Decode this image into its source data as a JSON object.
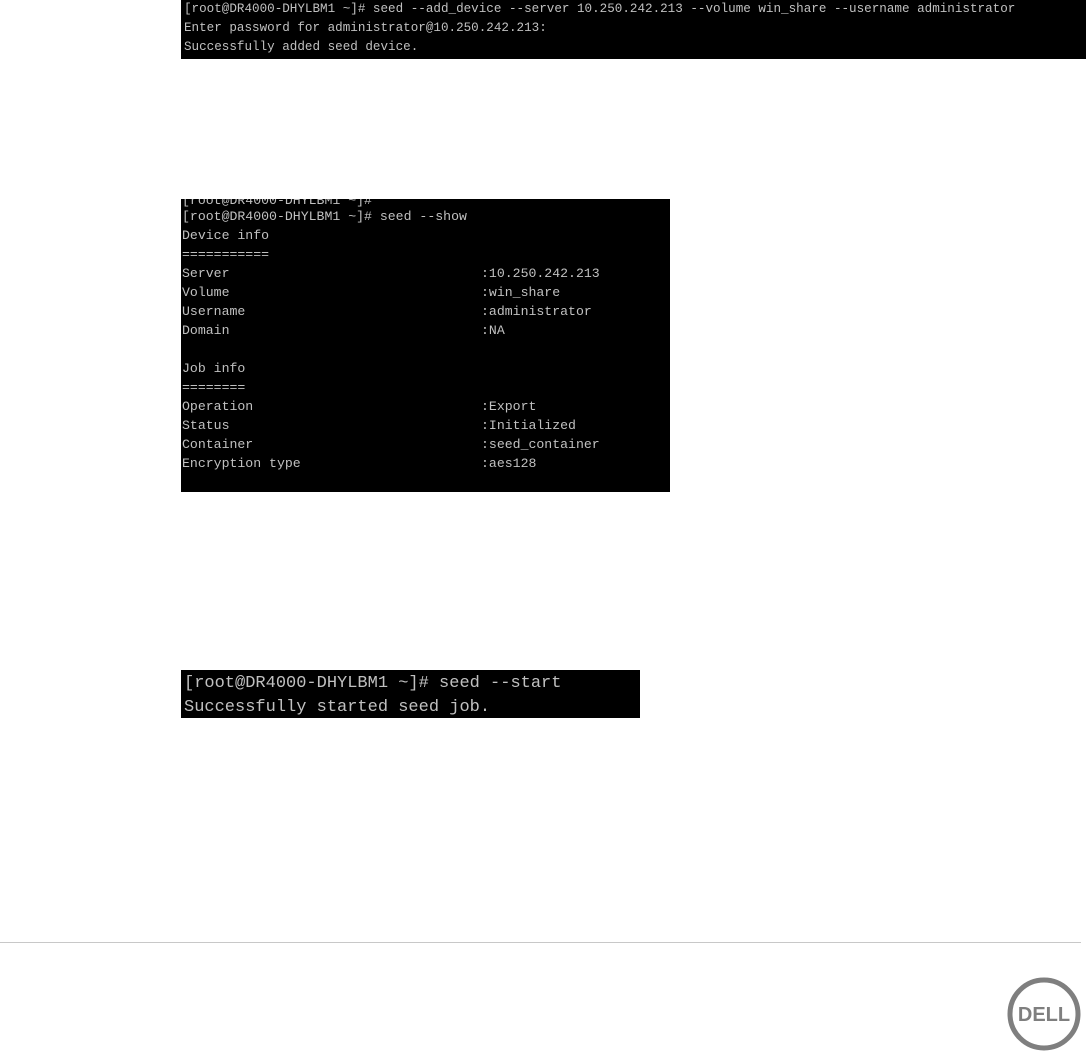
{
  "add_device_terminal": {
    "lines": [
      "[root@DR4000-DHYLBM1 ~]# seed --add_device --server 10.250.242.213 --volume win_share --username administrator",
      "Enter password for administrator@10.250.242.213:",
      "Successfully added seed device."
    ]
  },
  "show_terminal": {
    "partial_line": "[root@DR4000-DHYLBM1 ~]#",
    "prompt": "[root@DR4000-DHYLBM1 ~]# seed --show",
    "device_info": {
      "heading": "Device info",
      "rule": "===========",
      "rows": [
        {
          "key": "Server",
          "value": ":10.250.242.213"
        },
        {
          "key": "Volume",
          "value": ":win_share"
        },
        {
          "key": "Username",
          "value": ":administrator"
        },
        {
          "key": "Domain",
          "value": ":NA"
        }
      ]
    },
    "job_info": {
      "heading": "Job info",
      "rule": "========",
      "rows": [
        {
          "key": "Operation",
          "value": ":Export"
        },
        {
          "key": "Status",
          "value": ":Initialized"
        },
        {
          "key": "Container",
          "value": ":seed_container"
        },
        {
          "key": "Encryption type",
          "value": ":aes128"
        }
      ]
    }
  },
  "start_terminal": {
    "lines": [
      "[root@DR4000-DHYLBM1 ~]# seed --start",
      "Successfully started seed job."
    ]
  },
  "footer": {
    "logo_text": "DELL"
  },
  "colors": {
    "terminal_bg": "#000000",
    "terminal_text": "#c0c0c0",
    "logo_gray": "#7f7f7f"
  }
}
